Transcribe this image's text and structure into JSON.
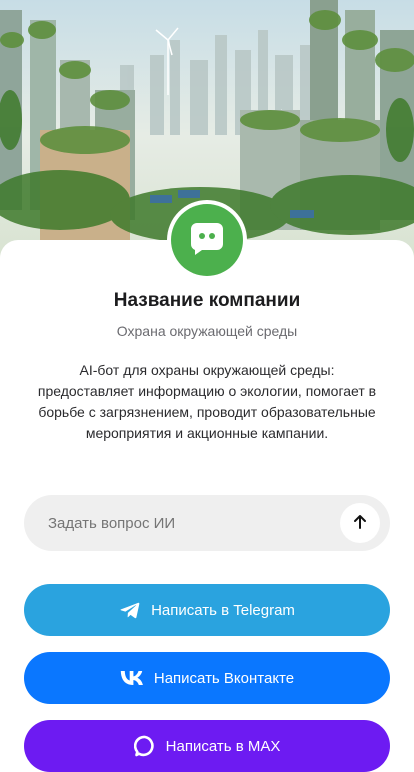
{
  "company": {
    "name": "Название компании",
    "category": "Охрана окружающей среды",
    "description": "AI-бот для охраны окружающей среды: предоставляет информацию о экологии, помогает в борьбе с загрязнением, проводит образовательные мероприятия и акционные кампании.",
    "avatar_icon": "chat-bubble-icon",
    "avatar_color": "#4cb04d"
  },
  "ask": {
    "placeholder": "Задать вопрос ИИ",
    "send_icon": "arrow-up-icon"
  },
  "actions": [
    {
      "label": "Написать в Telegram",
      "icon": "telegram-icon",
      "color": "#2aa3df"
    },
    {
      "label": "Написать Вконтакте",
      "icon": "vk-icon",
      "color": "#0a77ff"
    },
    {
      "label": "Написать в MAX",
      "icon": "max-icon",
      "color": "#6d1bf2"
    }
  ]
}
